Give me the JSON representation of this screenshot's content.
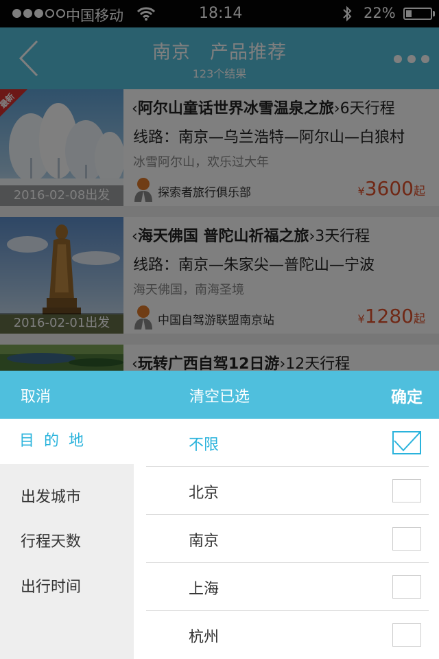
{
  "status_bar": {
    "carrier": "中国移动",
    "time": "18:14",
    "battery": "22%",
    "battery_level": 0.22
  },
  "header": {
    "title": "南京　产品推荐",
    "subtitle": "123个结果"
  },
  "products": [
    {
      "badge": "最新",
      "title": "阿尔山童话世界冰雪温泉之旅",
      "days": "6天行程",
      "route": "线路：南京—乌兰浩特—阿尔山—白狼村",
      "desc": "冰雪阿尔山，欢乐过大年",
      "agency": "探索者旅行俱乐部",
      "currency": "¥",
      "price": "3600",
      "price_suffix": "起",
      "date": "2016-02-08出发"
    },
    {
      "title": "海天佛国 普陀山祈福之旅",
      "days": "3天行程",
      "route": "线路：南京—朱家尖—普陀山—宁波",
      "desc": "海天佛国，南海圣境",
      "agency": "中国自驾游联盟南京站",
      "currency": "¥",
      "price": "1280",
      "price_suffix": "起",
      "date": "2016-02-01出发"
    },
    {
      "title": "玩转广西自驾12日游",
      "days": "12天行程"
    }
  ],
  "filter": {
    "cancel_label": "取消",
    "clear_label": "清空已选",
    "confirm_label": "确定",
    "categories": [
      {
        "label": "目的地",
        "active": true
      },
      {
        "label": "出发城市"
      },
      {
        "label": "行程天数"
      },
      {
        "label": "出行时间"
      }
    ],
    "options": [
      {
        "label": "不限",
        "selected": true
      },
      {
        "label": "北京"
      },
      {
        "label": "南京"
      },
      {
        "label": "上海"
      },
      {
        "label": "杭州"
      }
    ]
  },
  "colors": {
    "accent": "#4fbfdd",
    "price": "#e0502a",
    "badge": "#d8302e"
  }
}
